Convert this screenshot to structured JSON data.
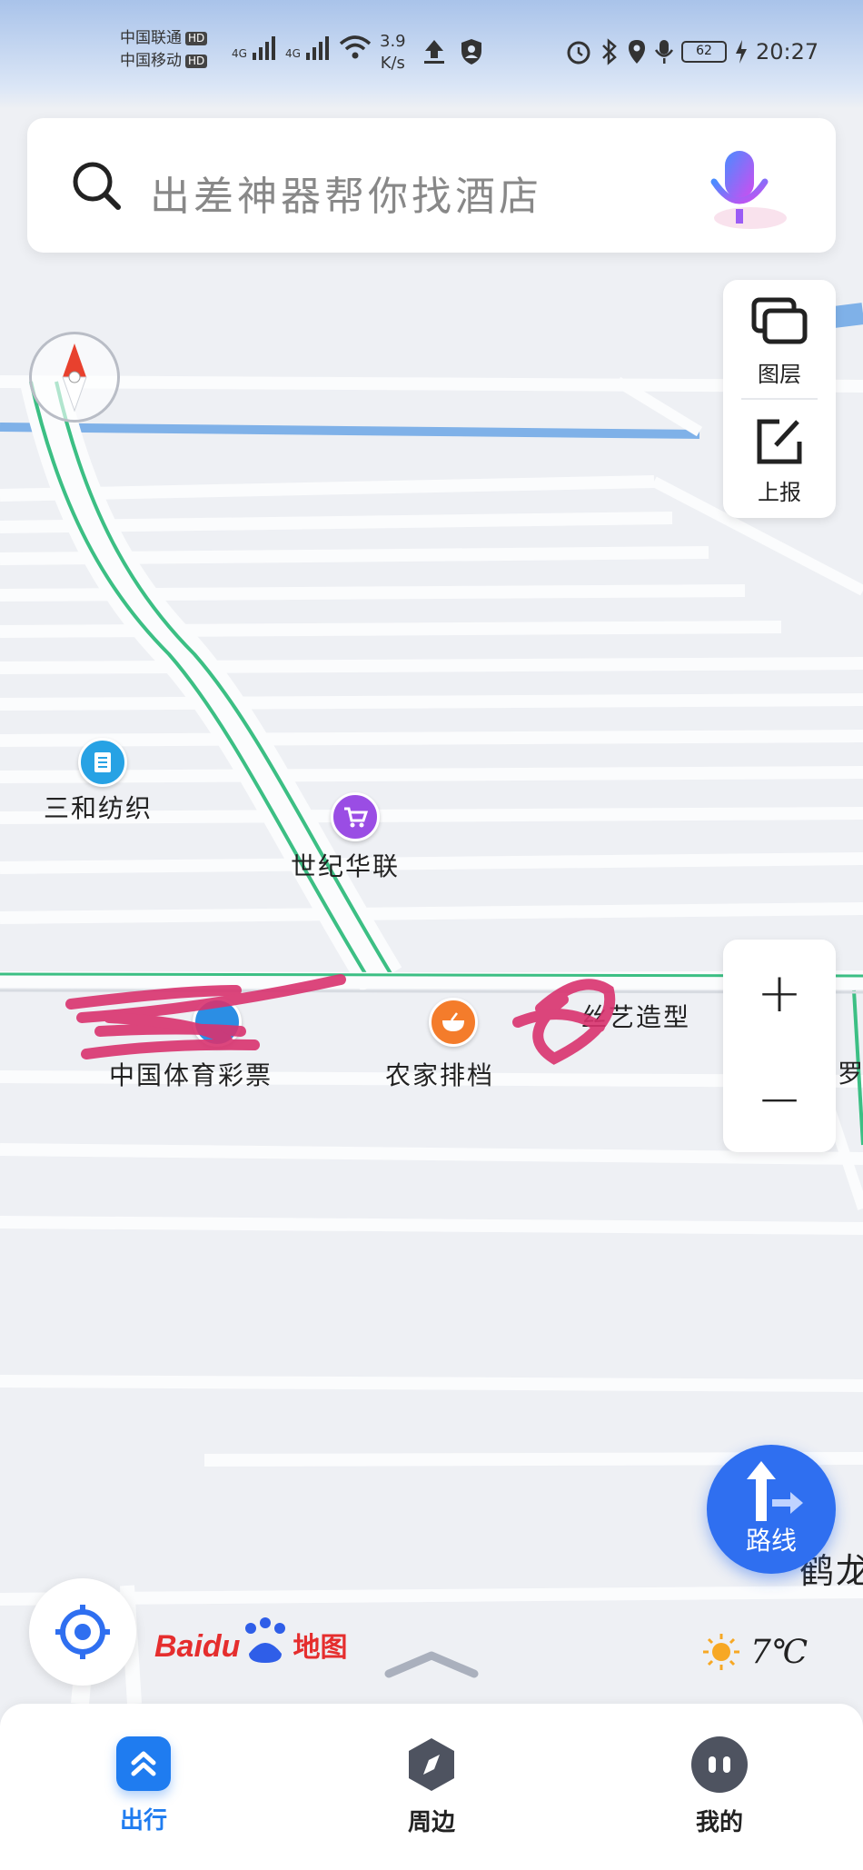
{
  "status_bar": {
    "carrier1": "中国联通",
    "carrier2": "中国移动",
    "hd": "HD",
    "net1": "4G",
    "net2": "4G",
    "speed_value": "3.9",
    "speed_unit": "K/s",
    "battery": "62",
    "time": "20:27"
  },
  "search": {
    "placeholder": "出差神器帮你找酒店"
  },
  "map_controls": {
    "layers_label": "图层",
    "report_label": "上报",
    "zoom_in": "+",
    "zoom_out": "−"
  },
  "map_labels": {
    "poi_sanhe": "三和纺织",
    "poi_shiji": "世纪华联",
    "poi_lottery": "中国体育彩票",
    "poi_nongjia": "农家排档",
    "poi_siyi": "丝艺造型",
    "poi_luo": "罗",
    "poi_he": "鹤龙"
  },
  "route_button": {
    "label": "路线"
  },
  "logo": {
    "text_baidu": "Baidu",
    "text_map": "地图"
  },
  "weather": {
    "temperature": "7℃"
  },
  "bottom_nav": {
    "items": [
      {
        "label": "出行",
        "active": true
      },
      {
        "label": "周边",
        "active": false
      },
      {
        "label": "我的",
        "active": false
      }
    ]
  },
  "colors": {
    "accent": "#2f6ff0",
    "route_green": "#3cbf84",
    "redaction": "#d9336f",
    "active_nav": "#1f7cf0"
  }
}
